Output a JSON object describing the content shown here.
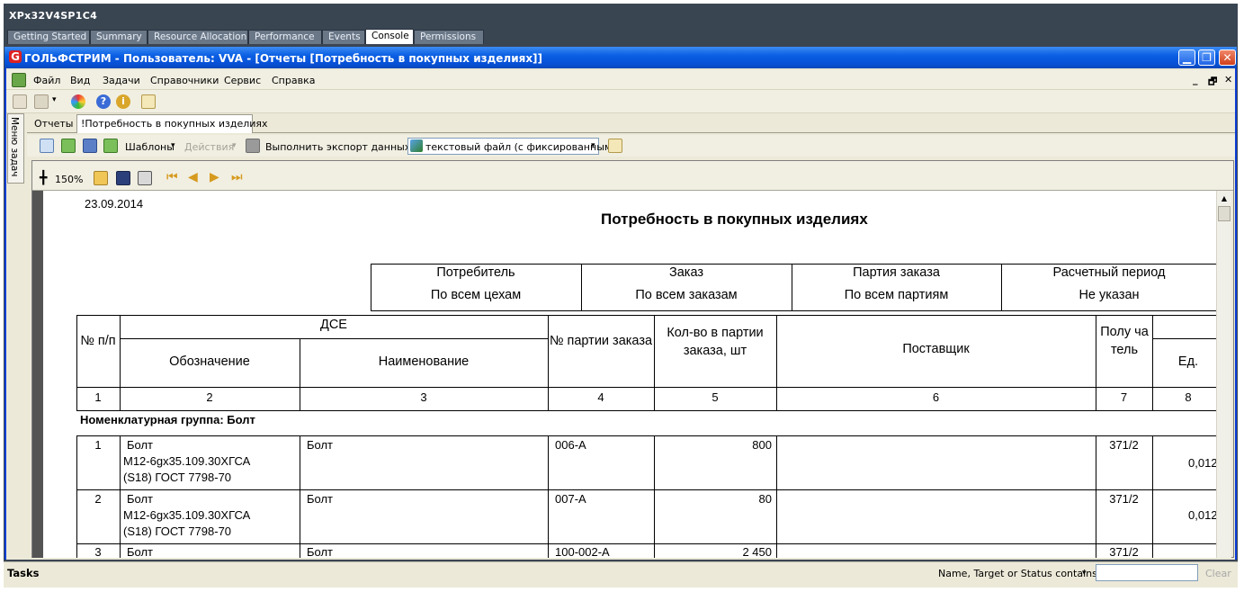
{
  "host": {
    "title": "XPx32V4SP1C4",
    "tabs": [
      "Getting Started",
      "Summary",
      "Resource Allocation",
      "Performance",
      "Events",
      "Console",
      "Permissions"
    ],
    "active_tab": "Console"
  },
  "app": {
    "logo_letter": "G",
    "title": "ГОЛЬФСТРИМ - Пользователь: VVA - [Отчеты  [Потребность в покупных изделиях]]",
    "menu": [
      "Файл",
      "Вид",
      "Задачи",
      "Справочники",
      "Сервис",
      "Справка"
    ],
    "mdi_controls": [
      "_",
      "🗗",
      "✕"
    ]
  },
  "task_menu": {
    "label": "Меню задач"
  },
  "doc_tabs": {
    "reports": "Отчеты",
    "active": "!Потребность в покупных изделиях"
  },
  "report_toolbar": {
    "templates": "Шаблоны",
    "actions": "Действия",
    "export_label": "Выполнить экспорт данных в:",
    "export_value": "текстовый файл (с фиксированным"
  },
  "viewer": {
    "zoom": "150%"
  },
  "report": {
    "date": "23.09.2014",
    "title": "Потребность в покупных изделиях",
    "filters": {
      "headers": [
        "Потребитель",
        "Заказ",
        "Партия заказа",
        "Расчетный период"
      ],
      "values": [
        "По всем цехам",
        "По всем заказам",
        "По всем партиям",
        "Не указан"
      ]
    },
    "table": {
      "col_no": "№ п/п",
      "col_dse": "ДСЕ",
      "col_designation": "Обозначение",
      "col_name": "Наименование",
      "col_batch": "№ партии заказа",
      "col_qty": "Кол-во в партии заказа, шт",
      "col_supplier": "Поставщик",
      "col_receiver": "Полу ча тель",
      "col_unit": "Ед.",
      "col_numbers": [
        "1",
        "2",
        "3",
        "4",
        "5",
        "6",
        "7",
        "8"
      ],
      "group": "Номенклатурная группа: Болт",
      "rows": [
        {
          "no": "1",
          "designation": [
            "Болт",
            "М12-6gх35.109.30ХГСА",
            "(S18) ГОСТ 7798-70"
          ],
          "name": "Болт",
          "batch": "006-А",
          "qty": "800",
          "supplier": "",
          "receiver": "371/2",
          "unit": "0,012"
        },
        {
          "no": "2",
          "designation": [
            "Болт",
            "М12-6gх35.109.30ХГСА",
            "(S18) ГОСТ 7798-70"
          ],
          "name": "Болт",
          "batch": "007-А",
          "qty": "80",
          "supplier": "",
          "receiver": "371/2",
          "unit": "0,012"
        },
        {
          "no": "3",
          "designation": [
            "Болт",
            "",
            ""
          ],
          "name": "Болт",
          "batch": "100-002-А",
          "qty": "2 450",
          "supplier": "",
          "receiver": "371/2",
          "unit": ""
        }
      ]
    }
  },
  "status": {
    "tasks": "Tasks",
    "filter_label": "Name, Target or Status contains:",
    "filter_value": "",
    "clear": "Clear"
  }
}
